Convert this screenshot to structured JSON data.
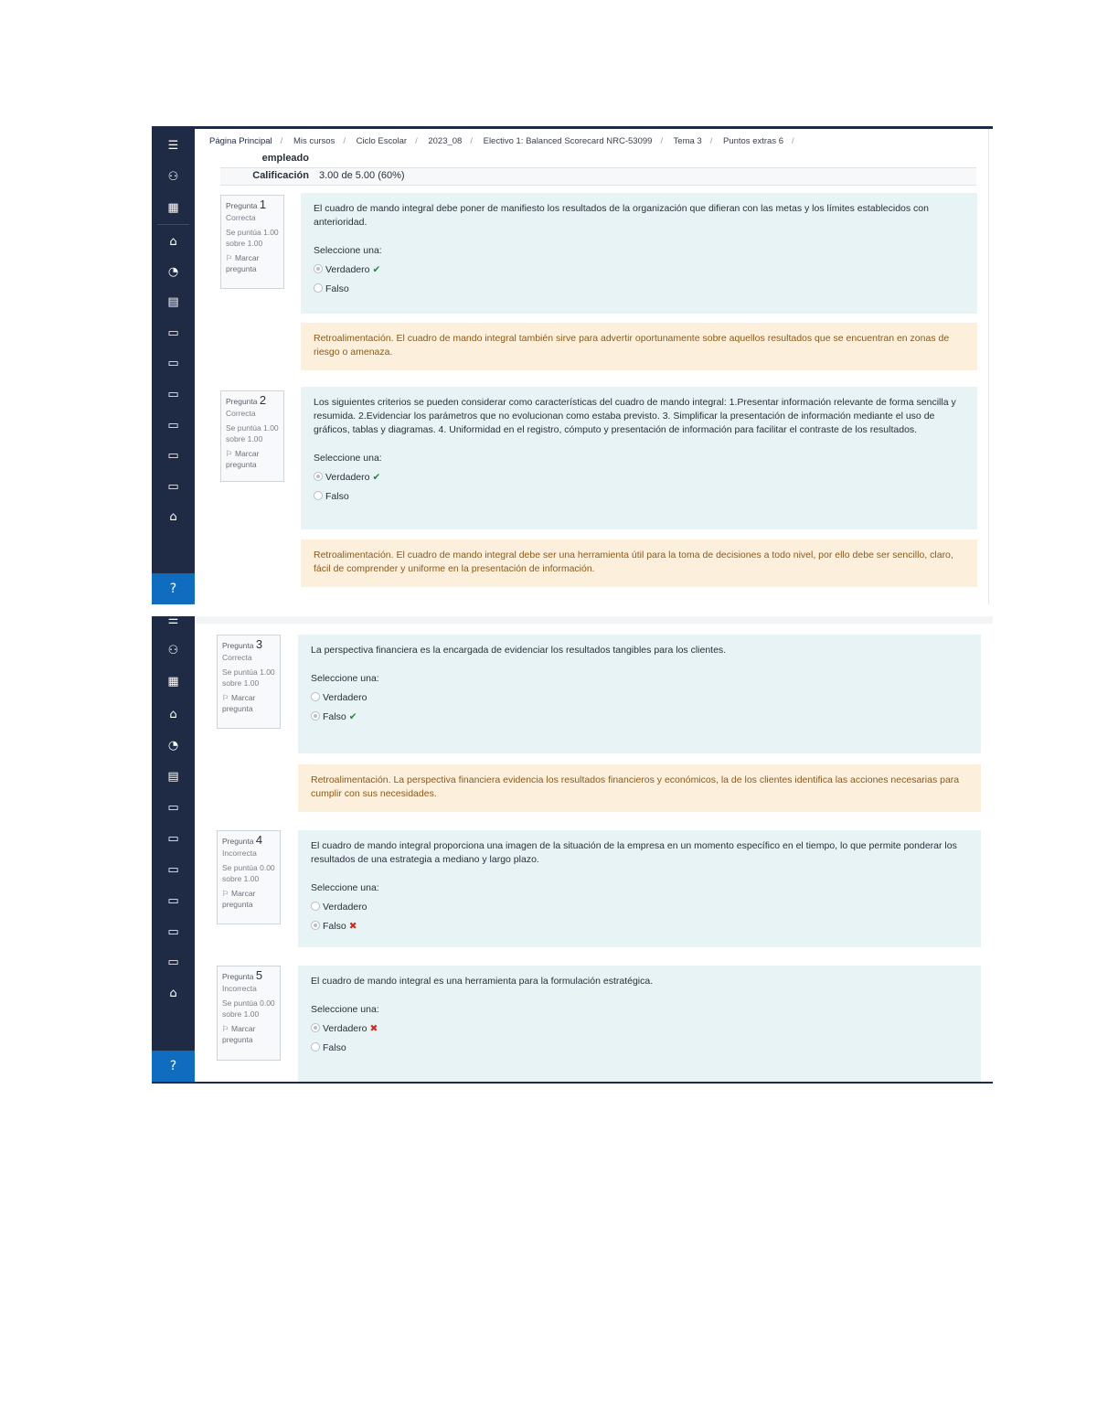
{
  "breadcrumb": [
    "Página Principal",
    "Mis cursos",
    "Ciclo Escolar",
    "2023_08",
    "Electivo 1: Balanced Scorecard NRC-53099",
    "Tema 3",
    "Puntos extras 6"
  ],
  "summary": {
    "empleado_label": "empleado",
    "calificacion_label": "Calificación",
    "calificacion_value": "3.00 de 5.00 (60%)"
  },
  "sidebar_icons": [
    "menu-icon",
    "user-icon",
    "grid-icon",
    "home-icon",
    "dashboard-icon",
    "calendar-icon",
    "folder-icon",
    "folder-icon",
    "folder-icon",
    "folder-icon",
    "folder-icon",
    "folder-icon",
    "graduation-cap-icon",
    "help-icon"
  ],
  "questions": [
    {
      "label": "Pregunta",
      "number": "1",
      "status": "Correcta",
      "grade": "Se puntúa 1.00 sobre 1.00",
      "flag": "Marcar pregunta",
      "text": "El cuadro de mando integral debe poner de manifiesto los resultados de la organización que difieran con las metas y los límites establecidos con anterioridad.",
      "prompt": "Seleccione una:",
      "option_a": "Verdadero",
      "option_b": "Falso",
      "feedback": "Retroalimentación. El cuadro de mando integral también sirve para advertir oportunamente sobre aquellos resultados que se encuentran en zonas de riesgo o amenaza."
    },
    {
      "label": "Pregunta",
      "number": "2",
      "status": "Correcta",
      "grade": "Se puntúa 1.00 sobre 1.00",
      "flag": "Marcar pregunta",
      "text": "Los siguientes criterios se pueden considerar como características del cuadro de mando integral: 1.Presentar información relevante de forma sencilla y resumida. 2.Evidenciar los parámetros que no evolucionan como estaba previsto. 3. Simplificar la presentación de información mediante el uso de gráficos, tablas y diagramas. 4. Uniformidad en el registro, cómputo y presentación de información para facilitar el contraste de los resultados.",
      "prompt": "Seleccione una:",
      "option_a": "Verdadero",
      "option_b": "Falso",
      "feedback": "Retroalimentación. El cuadro de mando integral debe ser una herramienta útil para la toma de decisiones a todo nivel, por ello debe ser sencillo, claro, fácil de comprender y uniforme en la presentación de información."
    },
    {
      "label": "Pregunta",
      "number": "3",
      "status": "Correcta",
      "grade": "Se puntúa 1.00 sobre 1.00",
      "flag": "Marcar pregunta",
      "text": "La perspectiva financiera es la encargada de evidenciar los resultados tangibles para los clientes.",
      "prompt": "Seleccione una:",
      "option_a": "Verdadero",
      "option_b": "Falso",
      "feedback": "Retroalimentación. La perspectiva financiera evidencia los resultados financieros y económicos, la de los clientes identifica las acciones necesarias para cumplir con sus necesidades."
    },
    {
      "label": "Pregunta",
      "number": "4",
      "status": "Incorrecta",
      "grade": "Se puntúa 0.00 sobre 1.00",
      "flag": "Marcar pregunta",
      "text": "El cuadro de mando integral proporciona una imagen de la situación de la empresa en un momento específico en el tiempo, lo que permite ponderar los resultados de una estrategia a mediano y largo plazo.",
      "prompt": "Seleccione una:",
      "option_a": "Verdadero",
      "option_b": "Falso"
    },
    {
      "label": "Pregunta",
      "number": "5",
      "status": "Incorrecta",
      "grade": "Se puntúa 0.00 sobre 1.00",
      "flag": "Marcar pregunta",
      "text": "El cuadro de mando integral es una herramienta para la formulación estratégica.",
      "prompt": "Seleccione una:",
      "option_a": "Verdadero",
      "option_b": "Falso"
    }
  ]
}
